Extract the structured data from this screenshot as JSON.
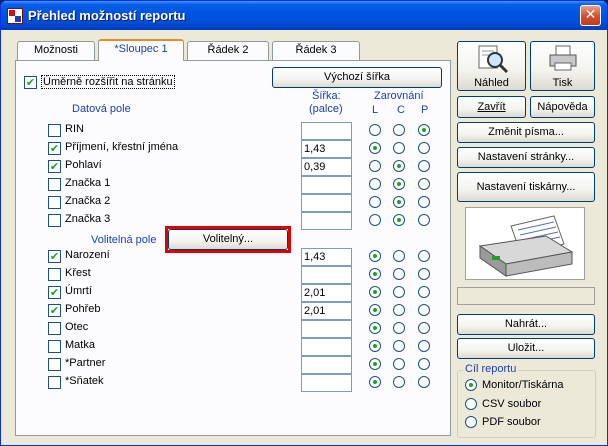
{
  "window": {
    "title": "Přehled možností reportu",
    "close_glyph": "✕"
  },
  "tabs": [
    {
      "label": "Možnosti"
    },
    {
      "label": "*Sloupec 1"
    },
    {
      "label": "Řádek 2"
    },
    {
      "label": "Řádek 3"
    }
  ],
  "panel": {
    "scale_checkbox": {
      "label": "Úměrně rozšířit na stránku",
      "checked": true
    },
    "default_width_button": "Výchozí šířka",
    "data_fields_header": "Datová pole",
    "width_header": "Šířka:",
    "width_unit": "(palce)",
    "align_header": "Zarovnání",
    "align_cols": [
      "L",
      "C",
      "P"
    ],
    "data_fields": [
      {
        "label": "RIN",
        "checked": false,
        "width": "",
        "align": "P"
      },
      {
        "label": "Příjmení, křestní jména",
        "checked": true,
        "width": "1,43",
        "align": "L"
      },
      {
        "label": "Pohlaví",
        "checked": true,
        "width": "0,39",
        "align": "C"
      },
      {
        "label": "Značka 1",
        "checked": false,
        "width": "",
        "align": "C"
      },
      {
        "label": "Značka 2",
        "checked": false,
        "width": "",
        "align": "C"
      },
      {
        "label": "Značka 3",
        "checked": false,
        "width": "",
        "align": "C"
      }
    ],
    "optional_fields_header": "Volitelná pole",
    "optional_button": "Volitelný...",
    "optional_fields": [
      {
        "label": "Narození",
        "checked": true,
        "width": "1,43",
        "align": "L"
      },
      {
        "label": "Křest",
        "checked": false,
        "width": "",
        "align": "L"
      },
      {
        "label": "Úmrtí",
        "checked": true,
        "width": "2,01",
        "align": "L"
      },
      {
        "label": "Pohřeb",
        "checked": true,
        "width": "2,01",
        "align": "L"
      },
      {
        "label": "Otec",
        "checked": false,
        "width": "",
        "align": "L"
      },
      {
        "label": "Matka",
        "checked": false,
        "width": "",
        "align": "L"
      },
      {
        "label": "*Partner",
        "checked": false,
        "width": "",
        "align": "L"
      },
      {
        "label": "*Sňatek",
        "checked": false,
        "width": "",
        "align": "L"
      }
    ]
  },
  "sidebar": {
    "preview_button": "Náhled",
    "print_button": "Tisk",
    "close_button": "Zavřít",
    "help_button": "Nápověda",
    "change_fonts_button": "Změnit písma...",
    "page_setup_button": "Nastavení stránky...",
    "printer_setup_button": "Nastavení tiskárny...",
    "load_button": "Nahrát...",
    "save_button": "Uložit...",
    "target_group": {
      "title": "Cíl reportu",
      "options": [
        {
          "label": "Monitor/Tiskárna",
          "selected": true
        },
        {
          "label": "CSV soubor",
          "selected": false
        },
        {
          "label": "PDF soubor",
          "selected": false
        }
      ]
    }
  },
  "colors": {
    "accent": "#e68b2c",
    "titlebar": "#0054e3",
    "highlight_border": "#e00000"
  }
}
